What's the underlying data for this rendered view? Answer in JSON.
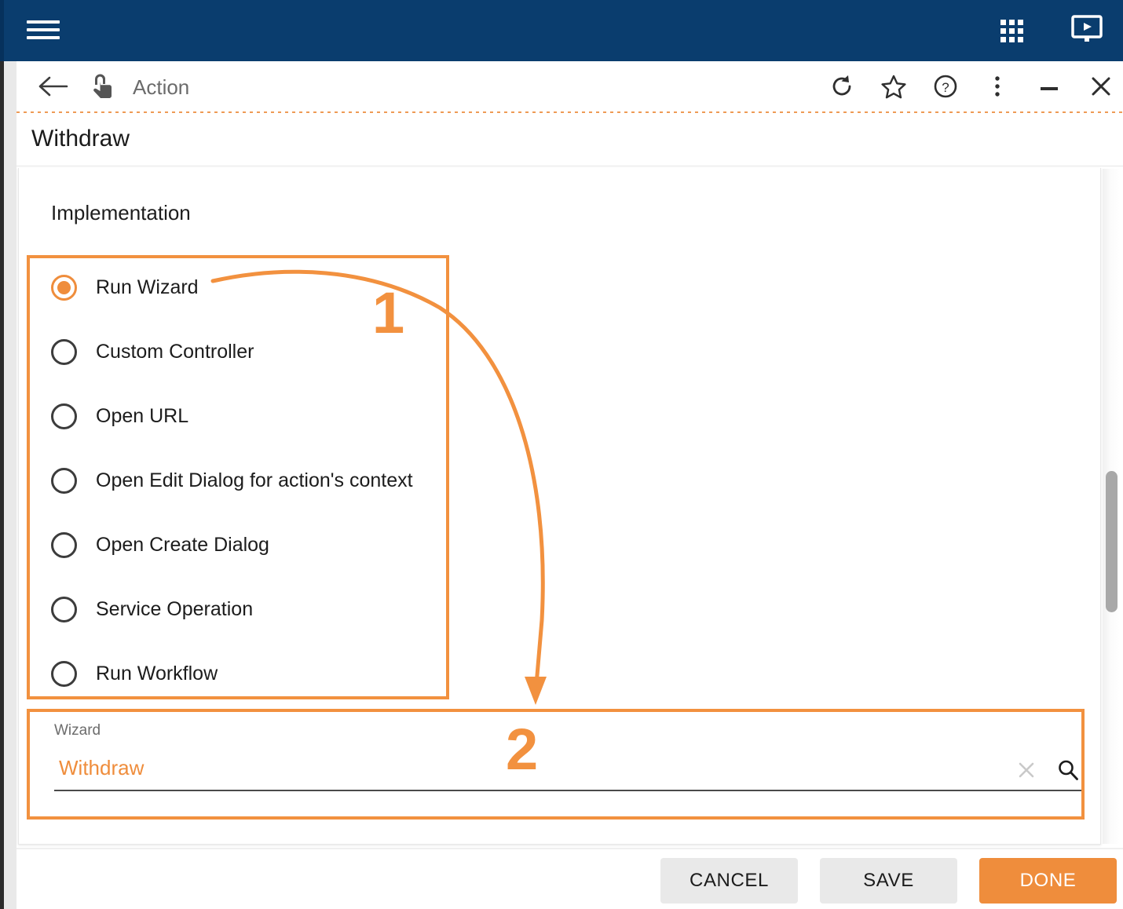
{
  "topbar": {
    "menu_icon": "hamburger-menu-icon",
    "apps_icon": "app-grid-icon",
    "media_icon": "screen-play-icon"
  },
  "toolbar": {
    "back_icon": "back-arrow-icon",
    "context_icon": "touch-hand-icon",
    "title": "Action",
    "refresh_icon": "refresh-icon",
    "favorite_icon": "star-icon",
    "help_icon": "help-question-icon",
    "more_icon": "more-vertical-icon",
    "minimize_icon": "minimize-icon",
    "close_icon": "close-icon"
  },
  "page": {
    "title": "Withdraw",
    "section_title": "Implementation"
  },
  "implementation": {
    "selected": "Run Wizard",
    "options": [
      {
        "label": "Run Wizard",
        "checked": true
      },
      {
        "label": "Custom Controller",
        "checked": false
      },
      {
        "label": "Open URL",
        "checked": false
      },
      {
        "label": "Open Edit Dialog for action's context",
        "checked": false
      },
      {
        "label": "Open Create Dialog",
        "checked": false
      },
      {
        "label": "Service Operation",
        "checked": false
      },
      {
        "label": "Run Workflow",
        "checked": false
      }
    ]
  },
  "wizard_field": {
    "label": "Wizard",
    "value": "Withdraw",
    "placeholder": "",
    "clear_icon": "clear-x-icon",
    "search_icon": "search-magnifier-icon"
  },
  "footer": {
    "cancel_label": "CANCEL",
    "save_label": "SAVE",
    "done_label": "DONE"
  },
  "annotations": {
    "step_one": "1",
    "step_two": "2"
  },
  "colors": {
    "navy": "#0a3d6e",
    "orange": "#ef8d3c",
    "annotation_orange": "#f2913f",
    "text_dark": "#1c1c1c",
    "text_muted": "#6c6c6c"
  }
}
